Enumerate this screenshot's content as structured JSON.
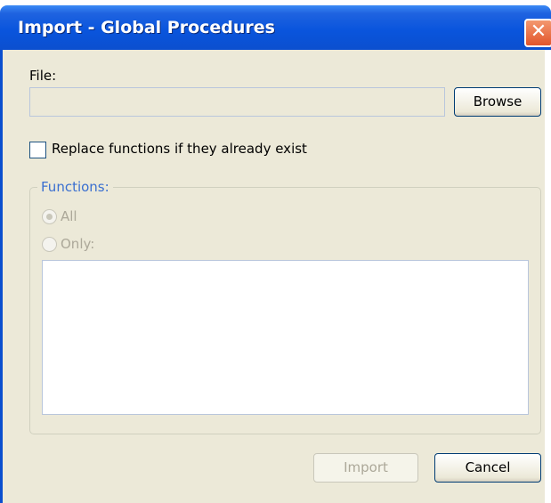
{
  "window": {
    "title": "Import - Global Procedures",
    "close_glyph": "✕"
  },
  "file": {
    "label": "File:",
    "value": "",
    "browse_label": "Browse"
  },
  "replace_checkbox": {
    "label": "Replace functions if they already exist",
    "checked": false
  },
  "functions": {
    "legend": "Functions:",
    "all_label": "All",
    "only_label": "Only:",
    "selected": "All",
    "items": []
  },
  "footer": {
    "import_label": "Import",
    "cancel_label": "Cancel"
  },
  "colors": {
    "titlebar": "#0b4fcf",
    "dialog_bg": "#ece9d8",
    "close_button": "#e2552b",
    "group_legend": "#3a6fd0"
  }
}
